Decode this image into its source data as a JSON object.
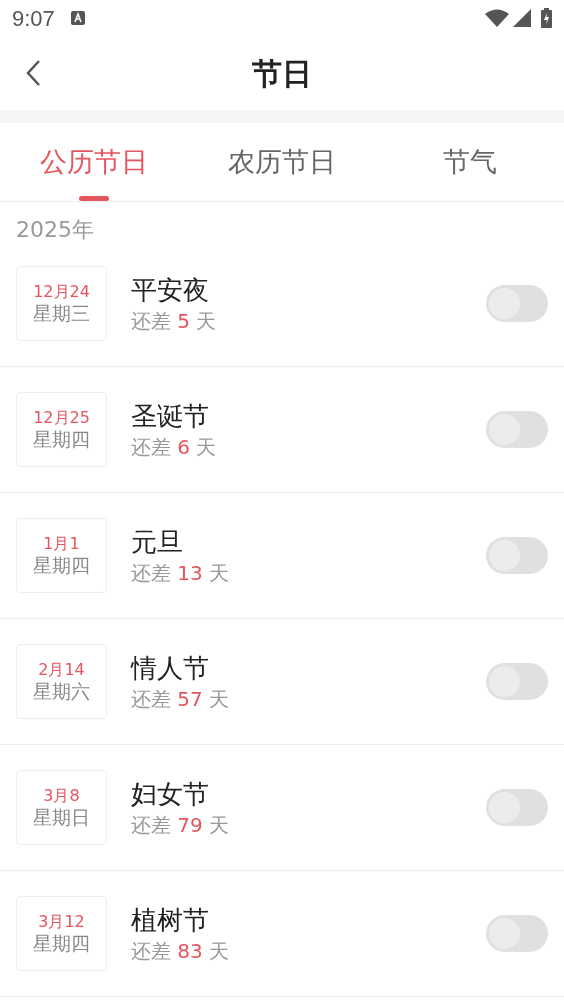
{
  "status_bar": {
    "time": "9:07"
  },
  "header": {
    "title": "节日"
  },
  "tabs": [
    {
      "label": "公历节日",
      "selected": true
    },
    {
      "label": "农历节日",
      "selected": false
    },
    {
      "label": "节气",
      "selected": false
    }
  ],
  "year": "2025年",
  "holidays": [
    {
      "date": "12月24",
      "weekday": "星期三",
      "name": "平安夜",
      "prefix": "还差",
      "days": "5",
      "suffix": "天",
      "on": false
    },
    {
      "date": "12月25",
      "weekday": "星期四",
      "name": "圣诞节",
      "prefix": "还差",
      "days": "6",
      "suffix": "天",
      "on": false
    },
    {
      "date": "1月1",
      "weekday": "星期四",
      "name": "元旦",
      "prefix": "还差",
      "days": "13",
      "suffix": "天",
      "on": false
    },
    {
      "date": "2月14",
      "weekday": "星期六",
      "name": "情人节",
      "prefix": "还差",
      "days": "57",
      "suffix": "天",
      "on": false
    },
    {
      "date": "3月8",
      "weekday": "星期日",
      "name": "妇女节",
      "prefix": "还差",
      "days": "79",
      "suffix": "天",
      "on": false
    },
    {
      "date": "3月12",
      "weekday": "星期四",
      "name": "植树节",
      "prefix": "还差",
      "days": "83",
      "suffix": "天",
      "on": false
    }
  ]
}
